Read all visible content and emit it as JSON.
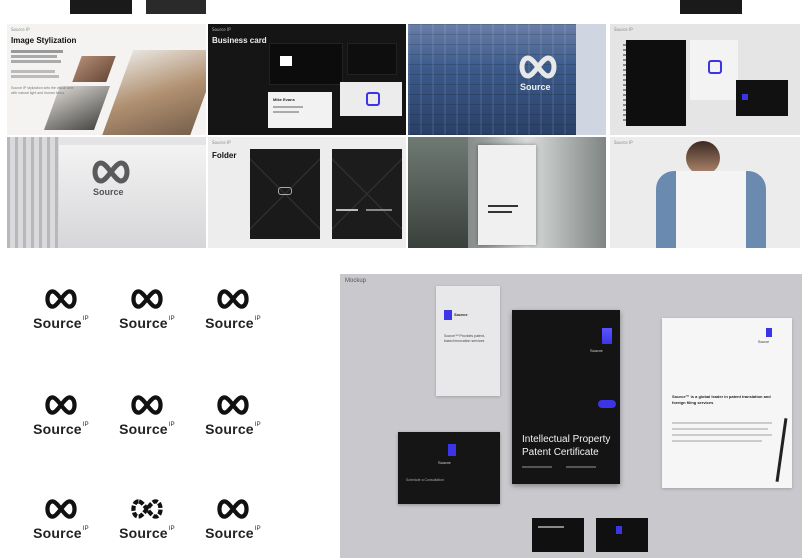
{
  "top_strips": [
    {
      "id": "a"
    },
    {
      "id": "b"
    },
    {
      "id": "c"
    }
  ],
  "tiles": {
    "image_stylization": {
      "label": "Source IP",
      "title": "Image Stylization",
      "lines": [
        "Source IP stylization sets the visual tone",
        "with natural light and human focus."
      ]
    },
    "business_card": {
      "label": "Source IP",
      "title": "Business card",
      "card_name": "Mike Evans"
    },
    "building": {
      "sign": "Source"
    },
    "notebook": {
      "label": "Source IP"
    },
    "wall_logo": {
      "label": "Source IP",
      "sign": "Source"
    },
    "folder": {
      "label": "Source IP",
      "title": "Folder"
    },
    "corridor": {
      "label": "Source IP"
    },
    "tshirt": {
      "label": "Source IP"
    }
  },
  "logo_grid": {
    "word": "Source",
    "mark": "IP",
    "count": 9
  },
  "mockup": {
    "label": "Mockup",
    "bookmark_brand": "Source",
    "bookmark_text": "Source™ Provides patent-based innovation services",
    "certificate_brand": "Source",
    "certificate_title_1": "Intellectual Property",
    "certificate_title_2": "Patent Certificate",
    "letter_brand": "Source",
    "letter_heading": "Source™ is a global leader in patent translation and foreign filing services",
    "small_card_brand": "Source",
    "small_card_text": "Schedule a Consultation"
  },
  "colors": {
    "accent": "#3b35e6",
    "dark": "#141414",
    "mockup_bg": "#c9c9cd"
  }
}
